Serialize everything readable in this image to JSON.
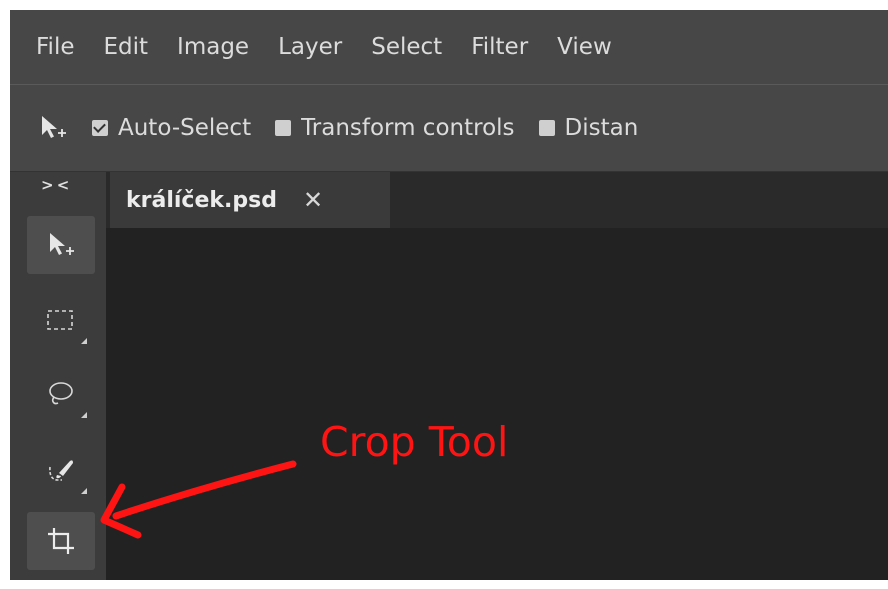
{
  "menubar": {
    "items": [
      "File",
      "Edit",
      "Image",
      "Layer",
      "Select",
      "Filter",
      "View"
    ]
  },
  "options": {
    "tool_icon": "move-tool-icon",
    "auto_select": {
      "label": "Auto-Select",
      "checked": true
    },
    "transform_controls": {
      "label": "Transform controls",
      "checked": false
    },
    "distance": {
      "label": "Distan",
      "checked": false
    }
  },
  "toolbar": {
    "collapse_label": "> <",
    "tools": [
      {
        "name": "move-tool",
        "icon": "move-icon",
        "active": true
      },
      {
        "name": "marquee-tool",
        "icon": "rect-select-icon",
        "active": false
      },
      {
        "name": "lasso-tool",
        "icon": "lasso-icon",
        "active": false
      },
      {
        "name": "quick-select-tool",
        "icon": "quick-select-brush-icon",
        "active": false
      },
      {
        "name": "crop-tool",
        "icon": "crop-icon",
        "active": true
      }
    ]
  },
  "document": {
    "tab_title": "králíček.psd",
    "close_glyph": "✕"
  },
  "annotation": {
    "text": "Crop Tool",
    "color": "#ff1414"
  },
  "colors": {
    "chrome": "#474747",
    "toolbar": "#3c3c3c",
    "canvas": "#222222"
  }
}
